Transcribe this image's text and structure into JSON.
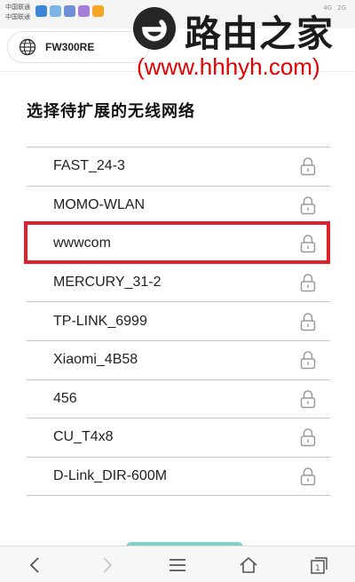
{
  "status_bar": {
    "carrier_1": "中国联通",
    "carrier_2": "中国联通",
    "signal_1": "4G",
    "signal_2": "2G",
    "notification_colors": [
      "#3b86d6",
      "#7bb4e6",
      "#6f8fd6",
      "#a67cd9",
      "#f5a623"
    ]
  },
  "address_bar": {
    "url": "FW300RE",
    "icon": "globe-icon"
  },
  "watermark": {
    "title": "路由之家",
    "url": "(www.hhhyh.com)",
    "logo_icon": "e-logo-icon"
  },
  "heading": "选择待扩展的无线网络",
  "networks": [
    {
      "name": "FAST_24-3",
      "icon": "lock-icon",
      "secured": true
    },
    {
      "name": "MOMO-WLAN",
      "icon": "lock-icon",
      "secured": true
    },
    {
      "name": "wwwcom",
      "icon": "lock-icon",
      "secured": true,
      "highlighted": true
    },
    {
      "name": "MERCURY_31-2",
      "icon": "lock-icon",
      "secured": true
    },
    {
      "name": "TP-LINK_6999",
      "icon": "lock-icon",
      "secured": true
    },
    {
      "name": "Xiaomi_4B58",
      "icon": "lock-icon",
      "secured": true
    },
    {
      "name": "456",
      "icon": "lock-icon",
      "secured": true
    },
    {
      "name": "CU_T4x8",
      "icon": "lock-icon",
      "secured": true
    },
    {
      "name": "D-Link_DIR-600M",
      "icon": "lock-icon",
      "secured": true
    }
  ],
  "bottom_nav": {
    "back_icon": "chevron-left-icon",
    "forward_icon": "chevron-right-icon",
    "menu_icon": "menu-icon",
    "home_icon": "home-icon",
    "tabs_icon": "tabs-icon",
    "tabs_count": "1"
  },
  "colors": {
    "highlight": "#e0202a",
    "watermark_url": "#e20000",
    "divider": "#c6c6c6",
    "teal_tab": "#7fd0c8"
  }
}
